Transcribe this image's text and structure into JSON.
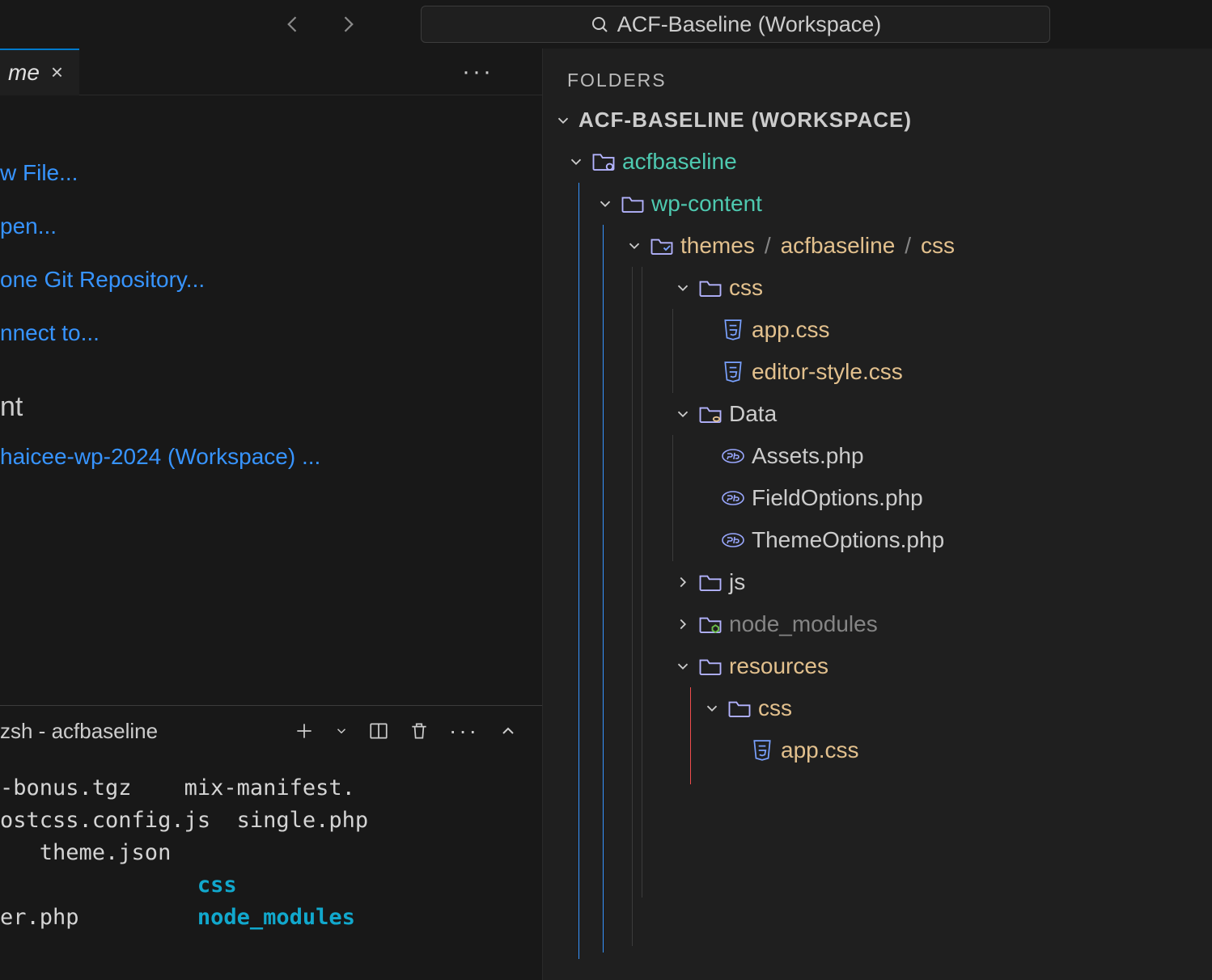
{
  "titlebar": {
    "search_text": "ACF-Baseline (Workspace)"
  },
  "tab": {
    "label": "me",
    "close": "×"
  },
  "tab_more": "···",
  "welcome_links": [
    "w File...",
    "pen...",
    "one Git Repository...",
    "nnect to..."
  ],
  "recent": {
    "heading": "nt",
    "item": "haicee-wp-2024 (Workspace) ..."
  },
  "terminal": {
    "title": "zsh - acfbaseline",
    "lines": [
      {
        "pre": "-bonus.tgz    mix-manifest."
      },
      {
        "pre": "ostcss.config.js  single.php"
      },
      {
        "pre": "   theme.json"
      },
      {
        "pre": "               ",
        "cyan": "css"
      },
      {
        "pre": "er.php         ",
        "cyan": "node_modules"
      }
    ]
  },
  "sidebar": {
    "title": "FOLDERS",
    "workspace": "ACF-BASELINE (WORKSPACE)",
    "root": "acfbaseline",
    "wp_content": "wp-content",
    "themes_path": {
      "a": "themes",
      "b": "acfbaseline",
      "c": "css"
    },
    "css": "css",
    "files_css": [
      "app.css",
      "editor-style.css"
    ],
    "data": "Data",
    "files_data": [
      "Assets.php",
      "FieldOptions.php",
      "ThemeOptions.php"
    ],
    "js": "js",
    "node_modules": "node_modules",
    "resources": "resources",
    "resources_css": "css",
    "resources_files": [
      "app.css"
    ]
  }
}
